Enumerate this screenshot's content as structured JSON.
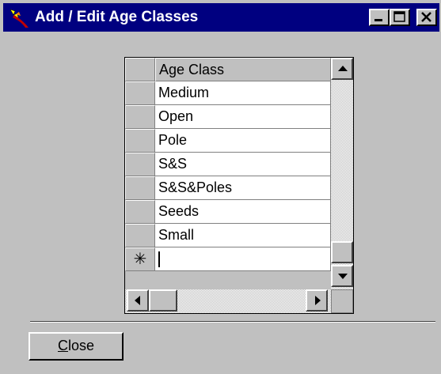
{
  "window": {
    "title": "Add / Edit Age Classes",
    "icon": "app-icon"
  },
  "titlebar_buttons": {
    "minimize_icon": "minimize-icon",
    "maximize_icon": "maximize-icon",
    "close_icon": "close-icon"
  },
  "grid": {
    "column_header": "Age Class",
    "rows": [
      "Medium",
      "Open",
      "Pole",
      "S&S",
      "S&S&Poles",
      "Seeds",
      "Small"
    ],
    "new_row_marker": "✳",
    "new_row_value": ""
  },
  "footer": {
    "close_accel": "C",
    "close_rest": "lose"
  },
  "colors": {
    "titlebar": "#000080",
    "face": "#c0c0c0",
    "cell": "#ffffff"
  }
}
